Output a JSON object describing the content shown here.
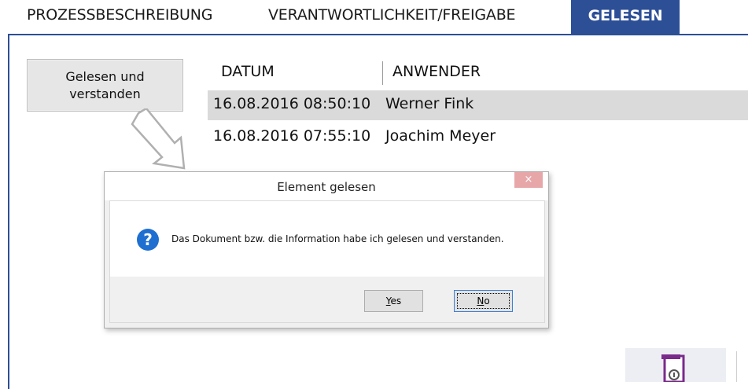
{
  "tabs": [
    {
      "label": "PROZESSBESCHREIBUNG"
    },
    {
      "label": "VERANTWORTLICHKEIT/FREIGABE"
    },
    {
      "label": "GELESEN"
    }
  ],
  "read_button": {
    "line1": "Gelesen und",
    "line2": "verstanden"
  },
  "table": {
    "headers": [
      "DATUM",
      "ANWENDER"
    ],
    "rows": [
      {
        "date": "16.08.2016 08:50:10",
        "user": "Werner Fink"
      },
      {
        "date": "16.08.2016 07:55:10",
        "user": "Joachim Meyer"
      }
    ]
  },
  "dialog": {
    "title": "Element gelesen",
    "close": "×",
    "message": "Das Dokument bzw. die Information habe ich gelesen und verstanden.",
    "yes_mnemonic": "Y",
    "yes_rest": "es",
    "no_mnemonic": "N",
    "no_rest": "o",
    "icon": "question-icon"
  },
  "colors": {
    "accent": "#2c4f96",
    "selected_row": "#dadada"
  }
}
